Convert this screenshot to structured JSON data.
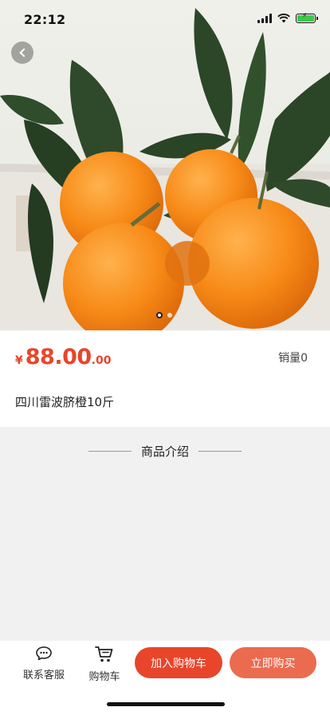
{
  "status_bar": {
    "time": "22:12"
  },
  "gallery": {
    "current_index": 1,
    "total": 2
  },
  "product": {
    "currency": "¥",
    "price_integer": "88.00",
    "price_decimal": ".00",
    "sales_label": "销量0",
    "title": "四川雷波脐橙10斤"
  },
  "section": {
    "intro_title": "商品介绍"
  },
  "bottom_bar": {
    "service_label": "联系客服",
    "cart_label": "购物车",
    "add_to_cart": "加入购物车",
    "buy_now": "立即购买"
  },
  "colors": {
    "accent": "#e8452b",
    "buy_button": "#eb6b4f",
    "background": "#f1f1f1"
  },
  "icons": {
    "back": "chevron-left-icon",
    "service": "chat-bubble-icon",
    "cart": "shopping-cart-icon"
  }
}
